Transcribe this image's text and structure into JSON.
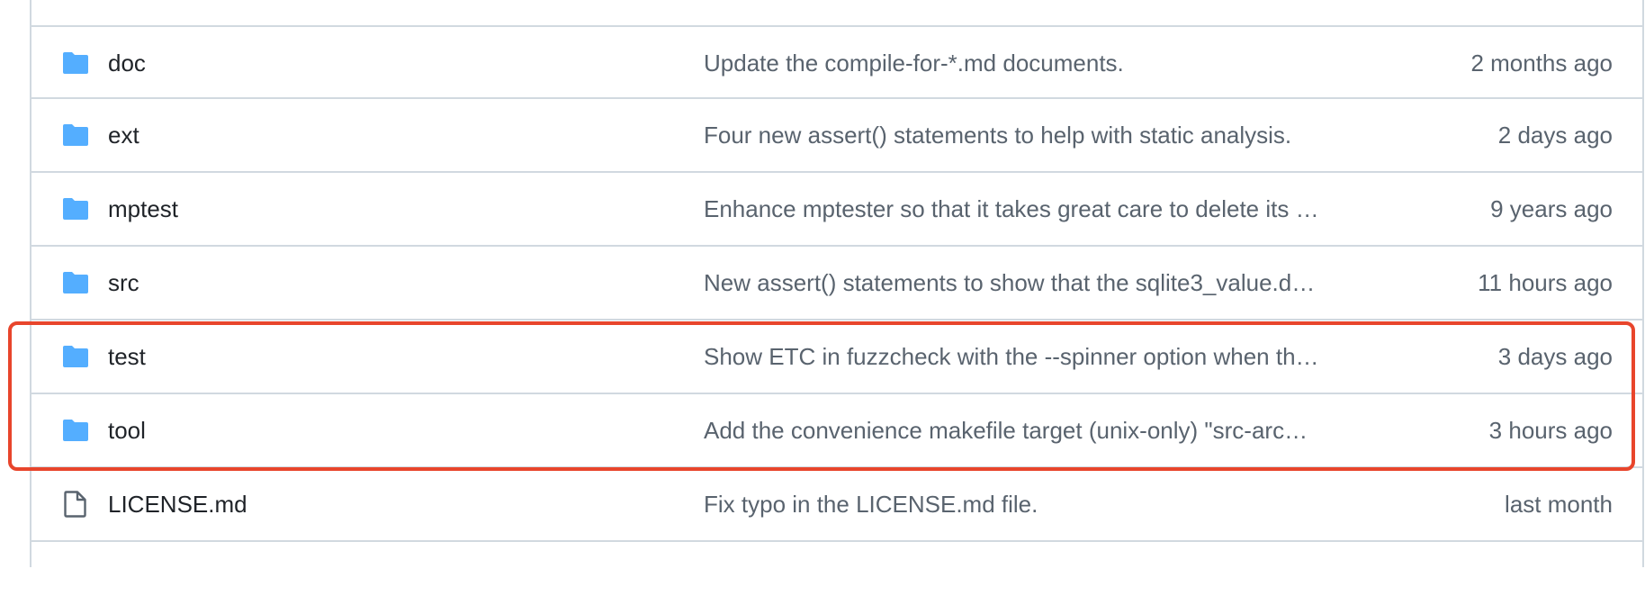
{
  "files": [
    {
      "type": "dir",
      "icon": "folder-icon",
      "name": "doc",
      "message": "Update the compile-for-*.md documents.",
      "time": "2 months ago"
    },
    {
      "type": "dir",
      "icon": "folder-icon",
      "name": "ext",
      "message": "Four new assert() statements to help with static analysis.",
      "time": "2 days ago"
    },
    {
      "type": "dir",
      "icon": "folder-icon",
      "name": "mptest",
      "message": "Enhance mptester so that it takes great care to delete its …",
      "time": "9 years ago"
    },
    {
      "type": "dir",
      "icon": "folder-icon",
      "name": "src",
      "message": "New assert() statements to show that the sqlite3_value.d…",
      "time": "11 hours ago"
    },
    {
      "type": "dir",
      "icon": "folder-icon",
      "name": "test",
      "message": "Show ETC in fuzzcheck with the --spinner option when th…",
      "time": "3 days ago"
    },
    {
      "type": "dir",
      "icon": "folder-icon",
      "name": "tool",
      "message": "Add the convenience makefile target (unix-only) \"src-arc…",
      "time": "3 hours ago"
    },
    {
      "type": "file",
      "icon": "file-icon",
      "name": "LICENSE.md",
      "message": "Fix typo in the LICENSE.md file.",
      "time": "last month"
    }
  ],
  "colors": {
    "folder": "#54aeff",
    "file_icon": "#59636e",
    "border": "#d1d9e0",
    "highlight": "#e8452c",
    "name_text": "#1f2328",
    "meta_text": "#59636e"
  }
}
